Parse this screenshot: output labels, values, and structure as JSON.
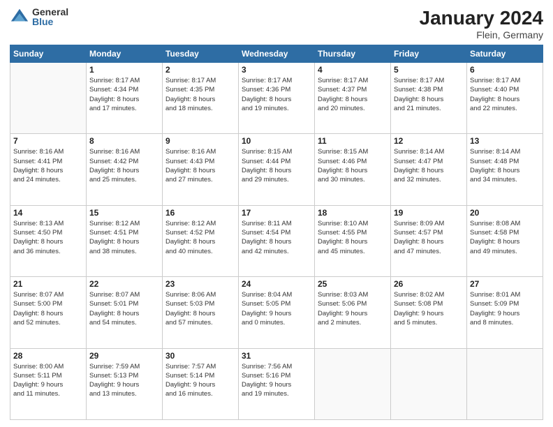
{
  "logo": {
    "general": "General",
    "blue": "Blue"
  },
  "title": "January 2024",
  "location": "Flein, Germany",
  "days_header": [
    "Sunday",
    "Monday",
    "Tuesday",
    "Wednesday",
    "Thursday",
    "Friday",
    "Saturday"
  ],
  "weeks": [
    [
      {
        "num": "",
        "sunrise": "",
        "sunset": "",
        "daylight": ""
      },
      {
        "num": "1",
        "sunrise": "Sunrise: 8:17 AM",
        "sunset": "Sunset: 4:34 PM",
        "daylight": "Daylight: 8 hours and 17 minutes."
      },
      {
        "num": "2",
        "sunrise": "Sunrise: 8:17 AM",
        "sunset": "Sunset: 4:35 PM",
        "daylight": "Daylight: 8 hours and 18 minutes."
      },
      {
        "num": "3",
        "sunrise": "Sunrise: 8:17 AM",
        "sunset": "Sunset: 4:36 PM",
        "daylight": "Daylight: 8 hours and 19 minutes."
      },
      {
        "num": "4",
        "sunrise": "Sunrise: 8:17 AM",
        "sunset": "Sunset: 4:37 PM",
        "daylight": "Daylight: 8 hours and 20 minutes."
      },
      {
        "num": "5",
        "sunrise": "Sunrise: 8:17 AM",
        "sunset": "Sunset: 4:38 PM",
        "daylight": "Daylight: 8 hours and 21 minutes."
      },
      {
        "num": "6",
        "sunrise": "Sunrise: 8:17 AM",
        "sunset": "Sunset: 4:40 PM",
        "daylight": "Daylight: 8 hours and 22 minutes."
      }
    ],
    [
      {
        "num": "7",
        "sunrise": "Sunrise: 8:16 AM",
        "sunset": "Sunset: 4:41 PM",
        "daylight": "Daylight: 8 hours and 24 minutes."
      },
      {
        "num": "8",
        "sunrise": "Sunrise: 8:16 AM",
        "sunset": "Sunset: 4:42 PM",
        "daylight": "Daylight: 8 hours and 25 minutes."
      },
      {
        "num": "9",
        "sunrise": "Sunrise: 8:16 AM",
        "sunset": "Sunset: 4:43 PM",
        "daylight": "Daylight: 8 hours and 27 minutes."
      },
      {
        "num": "10",
        "sunrise": "Sunrise: 8:15 AM",
        "sunset": "Sunset: 4:44 PM",
        "daylight": "Daylight: 8 hours and 29 minutes."
      },
      {
        "num": "11",
        "sunrise": "Sunrise: 8:15 AM",
        "sunset": "Sunset: 4:46 PM",
        "daylight": "Daylight: 8 hours and 30 minutes."
      },
      {
        "num": "12",
        "sunrise": "Sunrise: 8:14 AM",
        "sunset": "Sunset: 4:47 PM",
        "daylight": "Daylight: 8 hours and 32 minutes."
      },
      {
        "num": "13",
        "sunrise": "Sunrise: 8:14 AM",
        "sunset": "Sunset: 4:48 PM",
        "daylight": "Daylight: 8 hours and 34 minutes."
      }
    ],
    [
      {
        "num": "14",
        "sunrise": "Sunrise: 8:13 AM",
        "sunset": "Sunset: 4:50 PM",
        "daylight": "Daylight: 8 hours and 36 minutes."
      },
      {
        "num": "15",
        "sunrise": "Sunrise: 8:12 AM",
        "sunset": "Sunset: 4:51 PM",
        "daylight": "Daylight: 8 hours and 38 minutes."
      },
      {
        "num": "16",
        "sunrise": "Sunrise: 8:12 AM",
        "sunset": "Sunset: 4:52 PM",
        "daylight": "Daylight: 8 hours and 40 minutes."
      },
      {
        "num": "17",
        "sunrise": "Sunrise: 8:11 AM",
        "sunset": "Sunset: 4:54 PM",
        "daylight": "Daylight: 8 hours and 42 minutes."
      },
      {
        "num": "18",
        "sunrise": "Sunrise: 8:10 AM",
        "sunset": "Sunset: 4:55 PM",
        "daylight": "Daylight: 8 hours and 45 minutes."
      },
      {
        "num": "19",
        "sunrise": "Sunrise: 8:09 AM",
        "sunset": "Sunset: 4:57 PM",
        "daylight": "Daylight: 8 hours and 47 minutes."
      },
      {
        "num": "20",
        "sunrise": "Sunrise: 8:08 AM",
        "sunset": "Sunset: 4:58 PM",
        "daylight": "Daylight: 8 hours and 49 minutes."
      }
    ],
    [
      {
        "num": "21",
        "sunrise": "Sunrise: 8:07 AM",
        "sunset": "Sunset: 5:00 PM",
        "daylight": "Daylight: 8 hours and 52 minutes."
      },
      {
        "num": "22",
        "sunrise": "Sunrise: 8:07 AM",
        "sunset": "Sunset: 5:01 PM",
        "daylight": "Daylight: 8 hours and 54 minutes."
      },
      {
        "num": "23",
        "sunrise": "Sunrise: 8:06 AM",
        "sunset": "Sunset: 5:03 PM",
        "daylight": "Daylight: 8 hours and 57 minutes."
      },
      {
        "num": "24",
        "sunrise": "Sunrise: 8:04 AM",
        "sunset": "Sunset: 5:05 PM",
        "daylight": "Daylight: 9 hours and 0 minutes."
      },
      {
        "num": "25",
        "sunrise": "Sunrise: 8:03 AM",
        "sunset": "Sunset: 5:06 PM",
        "daylight": "Daylight: 9 hours and 2 minutes."
      },
      {
        "num": "26",
        "sunrise": "Sunrise: 8:02 AM",
        "sunset": "Sunset: 5:08 PM",
        "daylight": "Daylight: 9 hours and 5 minutes."
      },
      {
        "num": "27",
        "sunrise": "Sunrise: 8:01 AM",
        "sunset": "Sunset: 5:09 PM",
        "daylight": "Daylight: 9 hours and 8 minutes."
      }
    ],
    [
      {
        "num": "28",
        "sunrise": "Sunrise: 8:00 AM",
        "sunset": "Sunset: 5:11 PM",
        "daylight": "Daylight: 9 hours and 11 minutes."
      },
      {
        "num": "29",
        "sunrise": "Sunrise: 7:59 AM",
        "sunset": "Sunset: 5:13 PM",
        "daylight": "Daylight: 9 hours and 13 minutes."
      },
      {
        "num": "30",
        "sunrise": "Sunrise: 7:57 AM",
        "sunset": "Sunset: 5:14 PM",
        "daylight": "Daylight: 9 hours and 16 minutes."
      },
      {
        "num": "31",
        "sunrise": "Sunrise: 7:56 AM",
        "sunset": "Sunset: 5:16 PM",
        "daylight": "Daylight: 9 hours and 19 minutes."
      },
      {
        "num": "",
        "sunrise": "",
        "sunset": "",
        "daylight": ""
      },
      {
        "num": "",
        "sunrise": "",
        "sunset": "",
        "daylight": ""
      },
      {
        "num": "",
        "sunrise": "",
        "sunset": "",
        "daylight": ""
      }
    ]
  ]
}
